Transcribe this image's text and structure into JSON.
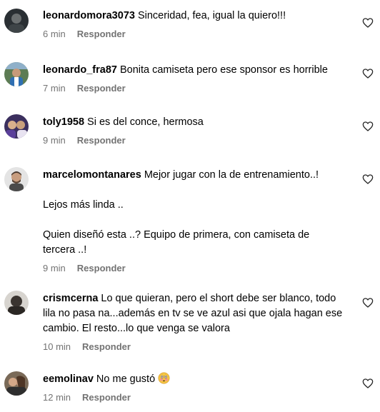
{
  "reply_label": "Responder",
  "comments": [
    {
      "username": "leonardomora3073",
      "paragraphs": [
        "Sinceridad, fea, igual la quiero!!!"
      ],
      "time": "6 min"
    },
    {
      "username": "leonardo_fra87",
      "paragraphs": [
        "Bonita camiseta pero ese sponsor es horrible"
      ],
      "time": "7 min"
    },
    {
      "username": "toly1958",
      "paragraphs": [
        "Si es del conce, hermosa"
      ],
      "time": "9 min"
    },
    {
      "username": "marcelomontanares",
      "paragraphs": [
        "Mejor jugar con la de entrenamiento..!",
        "Lejos más linda ..",
        "Quien diseñó esta ..? Equipo de primera, con camiseta de tercera ..!"
      ],
      "time": "9 min"
    },
    {
      "username": "crismcerna",
      "paragraphs": [
        "Lo que quieran, pero el short debe ser blanco, todo lila no pasa na...además en tv se ve azul asi que ojala hagan ese cambio. El resto...lo que venga se valora"
      ],
      "time": "10 min"
    },
    {
      "username": "eemolinav",
      "paragraphs": [
        "No me gustó"
      ],
      "time": "12 min",
      "emoji": "flushed-face-emoji"
    }
  ],
  "icons": {
    "like": "heart-icon"
  },
  "colors": {
    "meta_text": "#737373",
    "text": "#000000",
    "background": "#ffffff"
  }
}
